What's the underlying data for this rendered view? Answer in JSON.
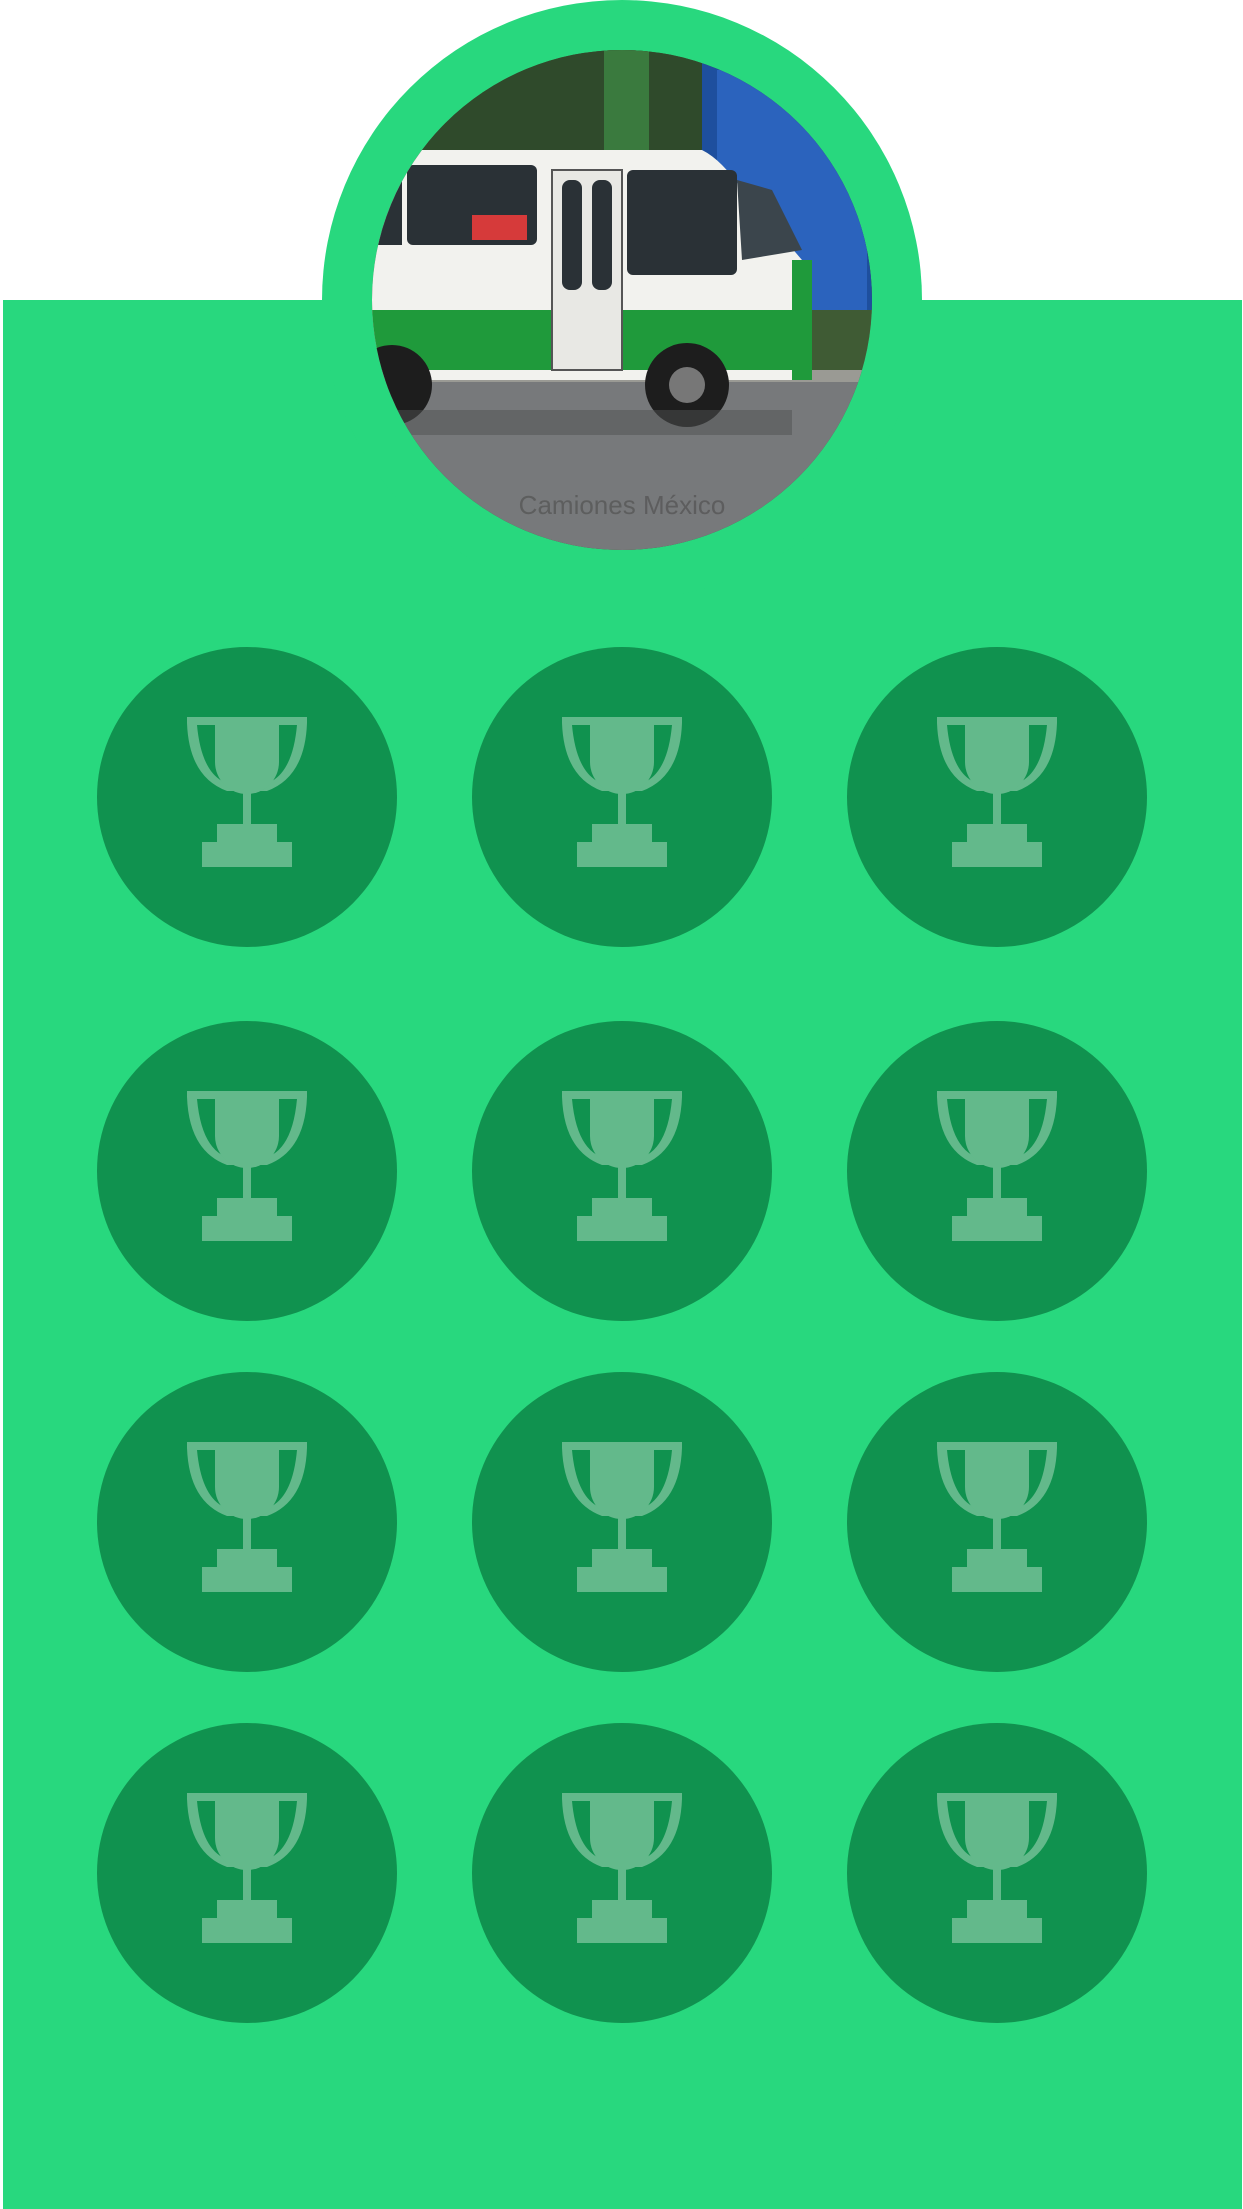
{
  "profile": {
    "photo_caption": "Camiones México"
  },
  "achievements": {
    "count": 12,
    "icon": "trophy-icon",
    "locked": true
  },
  "colors": {
    "panel": "#28d87e",
    "badge": "#10924f",
    "trophy": "#63b98b"
  }
}
